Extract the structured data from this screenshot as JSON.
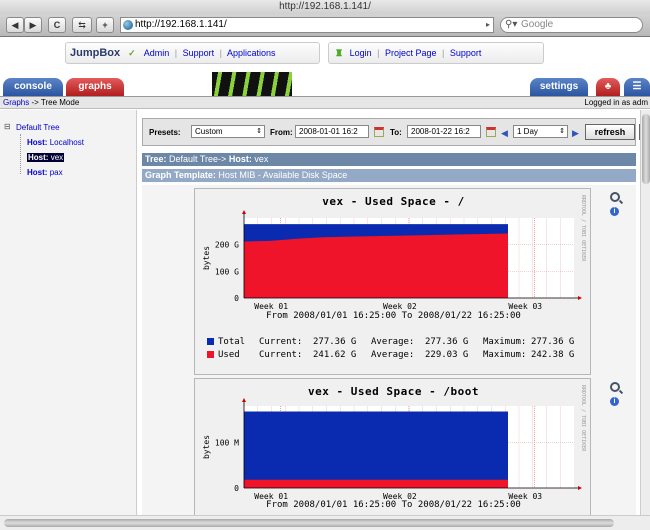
{
  "browser": {
    "title": "http://192.168.1.141/",
    "url": "http://192.168.1.141/",
    "search_placeholder": "Google",
    "back": "◀",
    "forward": "▶",
    "reload": "C",
    "plus": "+"
  },
  "jumpbox": {
    "logo": "JumpBox",
    "admin": "Admin",
    "support": "Support",
    "applications": "Applications",
    "login": "Login",
    "project_page": "Project Page",
    "support2": "Support"
  },
  "tabs": {
    "console": "console",
    "graphs": "graphs",
    "settings": "settings"
  },
  "breadcrumb": {
    "link": "Graphs",
    "rest": "-> Tree Mode",
    "logged_in": "Logged in as adm"
  },
  "tree": {
    "root": "Default Tree",
    "hosts": [
      {
        "prefix": "Host:",
        "name": "Localhost"
      },
      {
        "prefix": "Host:",
        "name": "vex"
      },
      {
        "prefix": "Host:",
        "name": "pax"
      }
    ]
  },
  "filter": {
    "presets_label": "Presets:",
    "presets_value": "Custom",
    "from_label": "From:",
    "from_value": "2008-01-01 16:2",
    "to_label": "To:",
    "to_value": "2008-01-22 16:2",
    "span_value": "1 Day",
    "refresh": "refresh"
  },
  "tree_header": {
    "tree_label": "Tree:",
    "tree_value": "Default Tree->",
    "host_label": "Host:",
    "host_value": "vex"
  },
  "template_header": {
    "label": "Graph Template:",
    "value": "Host MIB - Available Disk Space"
  },
  "colors": {
    "total": "#0a2bb0",
    "used": "#f0142b",
    "header_dark": "#6d87a7",
    "header_light": "#94a9c5"
  },
  "graphs": [
    {
      "title": "vex - Used Space - /",
      "ylabel": "bytes",
      "yticks": [
        "0",
        "100 G",
        "200 G"
      ],
      "xticks": [
        "Week 01",
        "Week 02",
        "Week 03"
      ],
      "range_text": "From 2008/01/01 16:25:00 To 2008/01/22 16:25:00",
      "side_text": "RRDTOOL / TOBI OETIKER",
      "legend": [
        {
          "name": "Total",
          "current_label": "Current:",
          "current": "277.36 G",
          "average_label": "Average:",
          "average": "277.36 G",
          "maximum_label": "Maximum:",
          "maximum": "277.36 G"
        },
        {
          "name": "Used",
          "current_label": "Current:",
          "current": "241.62 G",
          "average_label": "Average:",
          "average": "229.03 G",
          "maximum_label": "Maximum:",
          "maximum": "242.38 G"
        }
      ]
    },
    {
      "title": "vex - Used Space - /boot",
      "ylabel": "bytes",
      "yticks": [
        "0",
        "100 M"
      ],
      "xticks": [
        "Week 01",
        "Week 02",
        "Week 03"
      ],
      "range_text": "From 2008/01/01 16:25:00 To 2008/01/22 16:25:00",
      "side_text": "RRDTOOL / TOBI OETIKER"
    }
  ],
  "chart_data": [
    {
      "type": "area",
      "title": "vex - Used Space - /",
      "ylabel": "bytes",
      "x": [
        "2008-01-01",
        "2008-01-03",
        "2008-01-05",
        "2008-01-08",
        "2008-01-10",
        "2008-01-12",
        "2008-01-15",
        "2008-01-17",
        "2008-01-19",
        "2008-01-21",
        "2008-01-22"
      ],
      "xticks": [
        "Week 01",
        "Week 02",
        "Week 03"
      ],
      "ylim": [
        0,
        300
      ],
      "yunit": "G",
      "series": [
        {
          "name": "Total",
          "color": "#0a2bb0",
          "values": [
            277,
            277,
            277,
            277,
            277,
            277,
            277,
            277,
            277,
            277,
            277
          ]
        },
        {
          "name": "Used",
          "color": "#f0142b",
          "values": [
            212,
            214,
            222,
            228,
            230,
            232,
            234,
            236,
            238,
            240,
            242
          ]
        }
      ]
    },
    {
      "type": "area",
      "title": "vex - Used Space - /boot",
      "ylabel": "bytes",
      "x": [
        "2008-01-01",
        "2008-01-05",
        "2008-01-10",
        "2008-01-15",
        "2008-01-19",
        "2008-01-22"
      ],
      "xticks": [
        "Week 01",
        "Week 02",
        "Week 03"
      ],
      "ylim": [
        0,
        180
      ],
      "yunit": "M",
      "series": [
        {
          "name": "Total",
          "color": "#0a2bb0",
          "values": [
            168,
            168,
            168,
            168,
            168,
            168
          ]
        },
        {
          "name": "Used",
          "color": "#f0142b",
          "values": [
            18,
            18,
            18,
            18,
            18,
            18
          ]
        }
      ]
    }
  ]
}
